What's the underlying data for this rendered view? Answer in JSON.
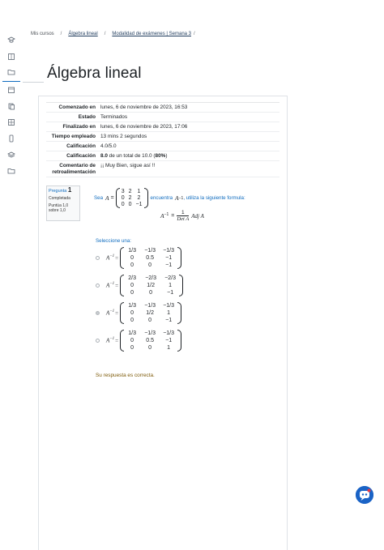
{
  "breadcrumb": {
    "item1": "Mis cursos",
    "item2": "Álgebra lineal",
    "item3": "Modalidad de exámenes | Semana 3",
    "sep": "/"
  },
  "page_title": "Álgebra lineal",
  "summary": [
    {
      "key": "Comenzado en",
      "value": "lunes, 6 de noviembre de 2023, 16:53"
    },
    {
      "key": "Estado",
      "value": "Terminados"
    },
    {
      "key": "Finalizado en",
      "value": "lunes, 6 de noviembre de 2023, 17:06"
    },
    {
      "key": "Tiempo empleado",
      "value": "13 mins 2 segundos"
    },
    {
      "key": "Calificación",
      "value": "4.0/5.0"
    },
    {
      "key": "Calificación",
      "value_bold": "8.0",
      "value_mid": " de un total de 10.0 (",
      "value_pct": "80%",
      "value_end": ")"
    },
    {
      "key": "Comentario de retroalimentación",
      "value": "¡¡ Muy Bien, sigue así !!"
    }
  ],
  "question": {
    "label": "Pregunta",
    "number": "1",
    "status": "Completada",
    "points": "Puntúa 1,0 sobre 1,0"
  },
  "prompt": {
    "sea": "Sea",
    "A": "A",
    "eq": "=",
    "matrix": [
      [
        "3",
        "2",
        "1"
      ],
      [
        "0",
        "2",
        "2"
      ],
      [
        "0",
        "0",
        "−1"
      ]
    ],
    "text": "encuentra",
    "inv": "A",
    "sup": "−1",
    "text2": ", utiliza la siguiente formula:",
    "formula_lhs": "A",
    "formula_sup": "−1",
    "formula_eq": "=",
    "numer": "1",
    "denom": "Det A",
    "adj": "Adj A"
  },
  "choose_label": "Seleccione una:",
  "options": [
    {
      "checked": false,
      "matrix": [
        [
          "1/3",
          "−1/3",
          "−1/3"
        ],
        [
          "0",
          "0.5",
          "−1"
        ],
        [
          "0",
          "0",
          "−1"
        ]
      ]
    },
    {
      "checked": false,
      "matrix": [
        [
          "2/3",
          "−2/3",
          "−2/3"
        ],
        [
          "0",
          "1/2",
          "1"
        ],
        [
          "0",
          "0",
          "−1"
        ]
      ]
    },
    {
      "checked": true,
      "matrix": [
        [
          "1/3",
          "−1/3",
          "−1/3"
        ],
        [
          "0",
          "1/2",
          "1"
        ],
        [
          "0",
          "0",
          "−1"
        ]
      ]
    },
    {
      "checked": false,
      "matrix": [
        [
          "1/3",
          "−1/3",
          "−1/3"
        ],
        [
          "0",
          "0.5",
          "−1"
        ],
        [
          "0",
          "0",
          "1"
        ]
      ]
    }
  ],
  "option_lhs": "A",
  "option_sup": "−1",
  "option_eq": "=",
  "feedback": "Su respuesta es correcta.",
  "sidebar_icons": [
    "hat-icon",
    "book-icon",
    "folder-icon",
    "calendar-icon",
    "files-icon",
    "grid-icon",
    "phone-icon",
    "layers-icon",
    "folder-icon"
  ]
}
